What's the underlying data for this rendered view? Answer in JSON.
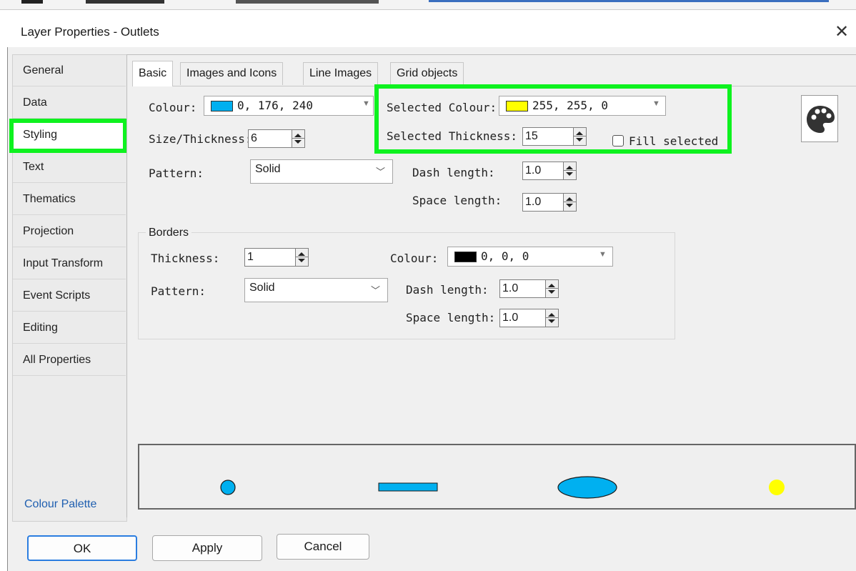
{
  "dialog": {
    "title": "Layer Properties - Outlets"
  },
  "sidebar": {
    "items": [
      {
        "label": "General"
      },
      {
        "label": "Data"
      },
      {
        "label": "Styling"
      },
      {
        "label": "Text"
      },
      {
        "label": "Thematics"
      },
      {
        "label": "Projection"
      },
      {
        "label": "Input Transform"
      },
      {
        "label": "Event Scripts"
      },
      {
        "label": "Editing"
      },
      {
        "label": "All Properties"
      }
    ],
    "selected": "Styling",
    "footer_link": "Colour Palette"
  },
  "tabs": [
    {
      "label": "Basic",
      "active": true
    },
    {
      "label": "Images and Icons"
    },
    {
      "label": "Line Images"
    },
    {
      "label": "Grid objects"
    }
  ],
  "basic": {
    "colour_label": "Colour:",
    "colour_value": "0, 176, 240",
    "colour_hex": "#00b0f0",
    "size_label": "Size/Thickness:",
    "size_value": "6",
    "pattern_label": "Pattern:",
    "pattern_value": "Solid",
    "selected_colour_label": "Selected Colour:",
    "selected_colour_value": "255, 255, 0",
    "selected_colour_hex": "#ffff00",
    "selected_thickness_label": "Selected Thickness:",
    "selected_thickness_value": "15",
    "fill_selected_label": "Fill selected",
    "fill_selected_checked": false,
    "dash_length_label": "Dash length:",
    "dash_length_value": "1.0",
    "space_length_label": "Space length:",
    "space_length_value": "1.0"
  },
  "borders": {
    "title": "Borders",
    "thickness_label": "Thickness:",
    "thickness_value": "1",
    "colour_label": "Colour:",
    "colour_value": "0, 0, 0",
    "colour_hex": "#000000",
    "pattern_label": "Pattern:",
    "pattern_value": "Solid",
    "dash_length_label": "Dash length:",
    "dash_length_value": "1.0",
    "space_length_label": "Space length:",
    "space_length_value": "1.0"
  },
  "buttons": {
    "ok": "OK",
    "apply": "Apply",
    "cancel": "Cancel"
  },
  "icons": {
    "close": "close-icon",
    "palette": "palette-icon"
  },
  "colors": {
    "highlight": "#0ef21f",
    "accent": "#2b7de0",
    "preview_fill": "#00b0f0",
    "selected_fill": "#ffff00"
  }
}
